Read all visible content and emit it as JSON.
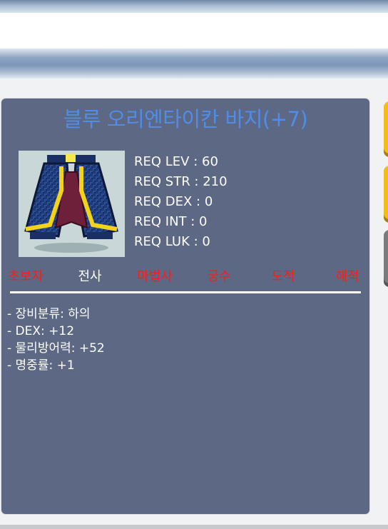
{
  "item": {
    "name": "블루 오리엔타이칸 바지(+7)",
    "icon": "pants-icon"
  },
  "requirements": [
    "REQ LEV : 60",
    "REQ STR : 210",
    "REQ DEX : 0",
    "REQ INT : 0",
    "REQ LUK : 0"
  ],
  "jobs": [
    {
      "label": "초보자",
      "allowed": false
    },
    {
      "label": "전사",
      "allowed": true
    },
    {
      "label": "마법사",
      "allowed": false
    },
    {
      "label": "궁수",
      "allowed": false
    },
    {
      "label": "도적",
      "allowed": false
    },
    {
      "label": "해적",
      "allowed": false
    }
  ],
  "stats": [
    "- 장비분류: 하의",
    "- DEX: +12",
    "- 물리방어력: +52",
    "- 명중률: +1"
  ],
  "colors": {
    "panel_bg": "#5d6884",
    "title": "#4f8de8",
    "job_allowed": "#ffffff",
    "job_disallowed": "#ff1a1a",
    "side_tab_accent": "#f2bd1a"
  }
}
